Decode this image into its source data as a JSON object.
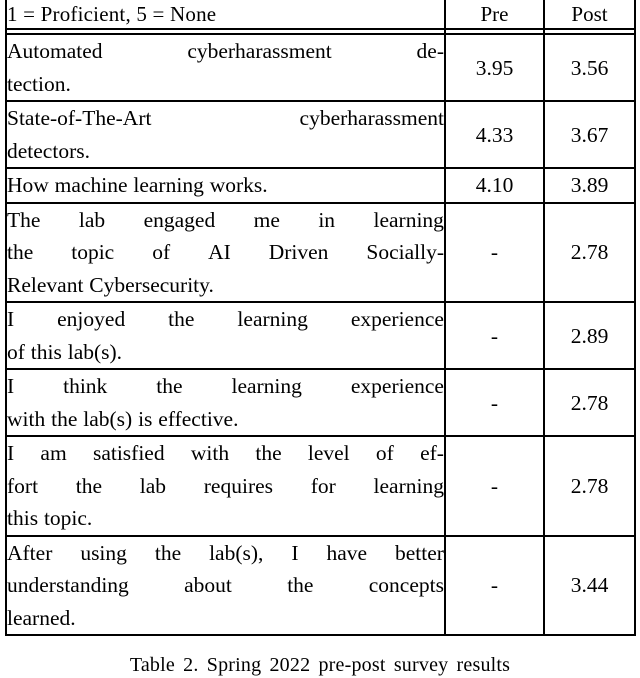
{
  "table": {
    "columns": [
      {
        "key": "statement",
        "label": "1 = Proficient, 5 = None",
        "align": "left"
      },
      {
        "key": "pre",
        "label": "Pre",
        "align": "center"
      },
      {
        "key": "post",
        "label": "Post",
        "align": "center"
      }
    ],
    "rows": [
      {
        "statement": "Automated cyberharassment de-tection.",
        "statement_lines": [
          "Automated cyberharassment de-",
          "tection."
        ],
        "pre": "3.95",
        "post": "3.56"
      },
      {
        "statement": "State-of-The-Art cyberharassment detectors.",
        "statement_lines": [
          "State-of-The-Art cyberharassment",
          "detectors."
        ],
        "pre": "4.33",
        "post": "3.67"
      },
      {
        "statement": "How machine learning works.",
        "statement_lines": [
          "How machine learning works."
        ],
        "pre": "4.10",
        "post": "3.89"
      },
      {
        "statement": "The lab engaged me in learning the topic of AI Driven Socially-Relevant Cybersecurity.",
        "statement_lines": [
          "The lab engaged me in learning",
          "the topic of AI Driven Socially-",
          "Relevant Cybersecurity."
        ],
        "pre": "-",
        "post": "2.78"
      },
      {
        "statement": "I enjoyed the learning experience of this lab(s).",
        "statement_lines": [
          "I enjoyed the learning experience",
          "of this lab(s)."
        ],
        "pre": "-",
        "post": "2.89"
      },
      {
        "statement": "I think the learning experience with the lab(s) is effective.",
        "statement_lines": [
          "I think the learning experience",
          "with the lab(s) is effective."
        ],
        "pre": "-",
        "post": "2.78"
      },
      {
        "statement": "I am satisfied with the level of ef-fort the lab requires for learning this topic.",
        "statement_lines": [
          "I am satisfied with the level of ef-",
          "fort the lab requires for learning",
          "this topic."
        ],
        "pre": "-",
        "post": "2.78"
      },
      {
        "statement": "After using the lab(s), I have better understanding about the concepts learned.",
        "statement_lines": [
          "After using the lab(s), I have better",
          "understanding about the concepts",
          "learned."
        ],
        "pre": "-",
        "post": "3.44"
      }
    ]
  },
  "caption": {
    "text": "Table 2. Spring 2022 pre-post survey results"
  }
}
